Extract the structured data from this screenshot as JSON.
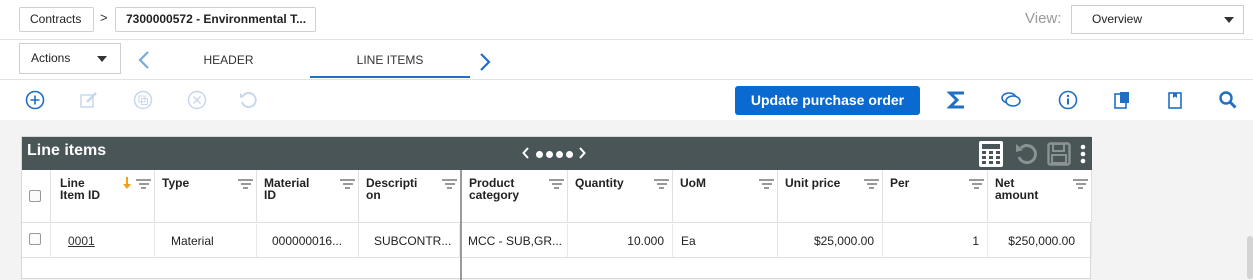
{
  "breadcrumb": {
    "root": "Contracts",
    "separator": ">",
    "current": "7300000572 - Environmental T..."
  },
  "view": {
    "label": "View:",
    "selected": "Overview"
  },
  "tabbar": {
    "actions_label": "Actions",
    "tabs": [
      {
        "label": "HEADER"
      },
      {
        "label": "LINE ITEMS",
        "active": true
      }
    ]
  },
  "toolbar": {
    "update_label": "Update purchase order",
    "left_icons": [
      "add-circle-icon",
      "edit-icon",
      "copy-icon",
      "delete-circle-icon",
      "undo-icon"
    ],
    "right_icons": [
      "sigma-icon",
      "chat-icon",
      "info-icon",
      "paste-icon",
      "clipboard-icon",
      "search-icon"
    ],
    "accent": "#1f6fc5"
  },
  "line_items": {
    "title": "Line items",
    "page_dots": 4,
    "columns": [
      {
        "label": "Line Item ID"
      },
      {
        "label": "Type"
      },
      {
        "label": "Material ID"
      },
      {
        "label": "Descripti on"
      },
      {
        "label": "Product category"
      },
      {
        "label": "Quantity"
      },
      {
        "label": "UoM"
      },
      {
        "label": "Unit price"
      },
      {
        "label": "Per"
      },
      {
        "label": "Net amount"
      }
    ],
    "rows": [
      {
        "line_item_id": "0001",
        "type": "Material",
        "material_id": "000000016...",
        "description": "SUBCONTR...",
        "product_category": "MCC - SUB,GR...",
        "quantity": "10.000",
        "uom": "Ea",
        "unit_price": "$25,000.00",
        "per": "1",
        "net_amount": "$250,000.00"
      }
    ]
  }
}
